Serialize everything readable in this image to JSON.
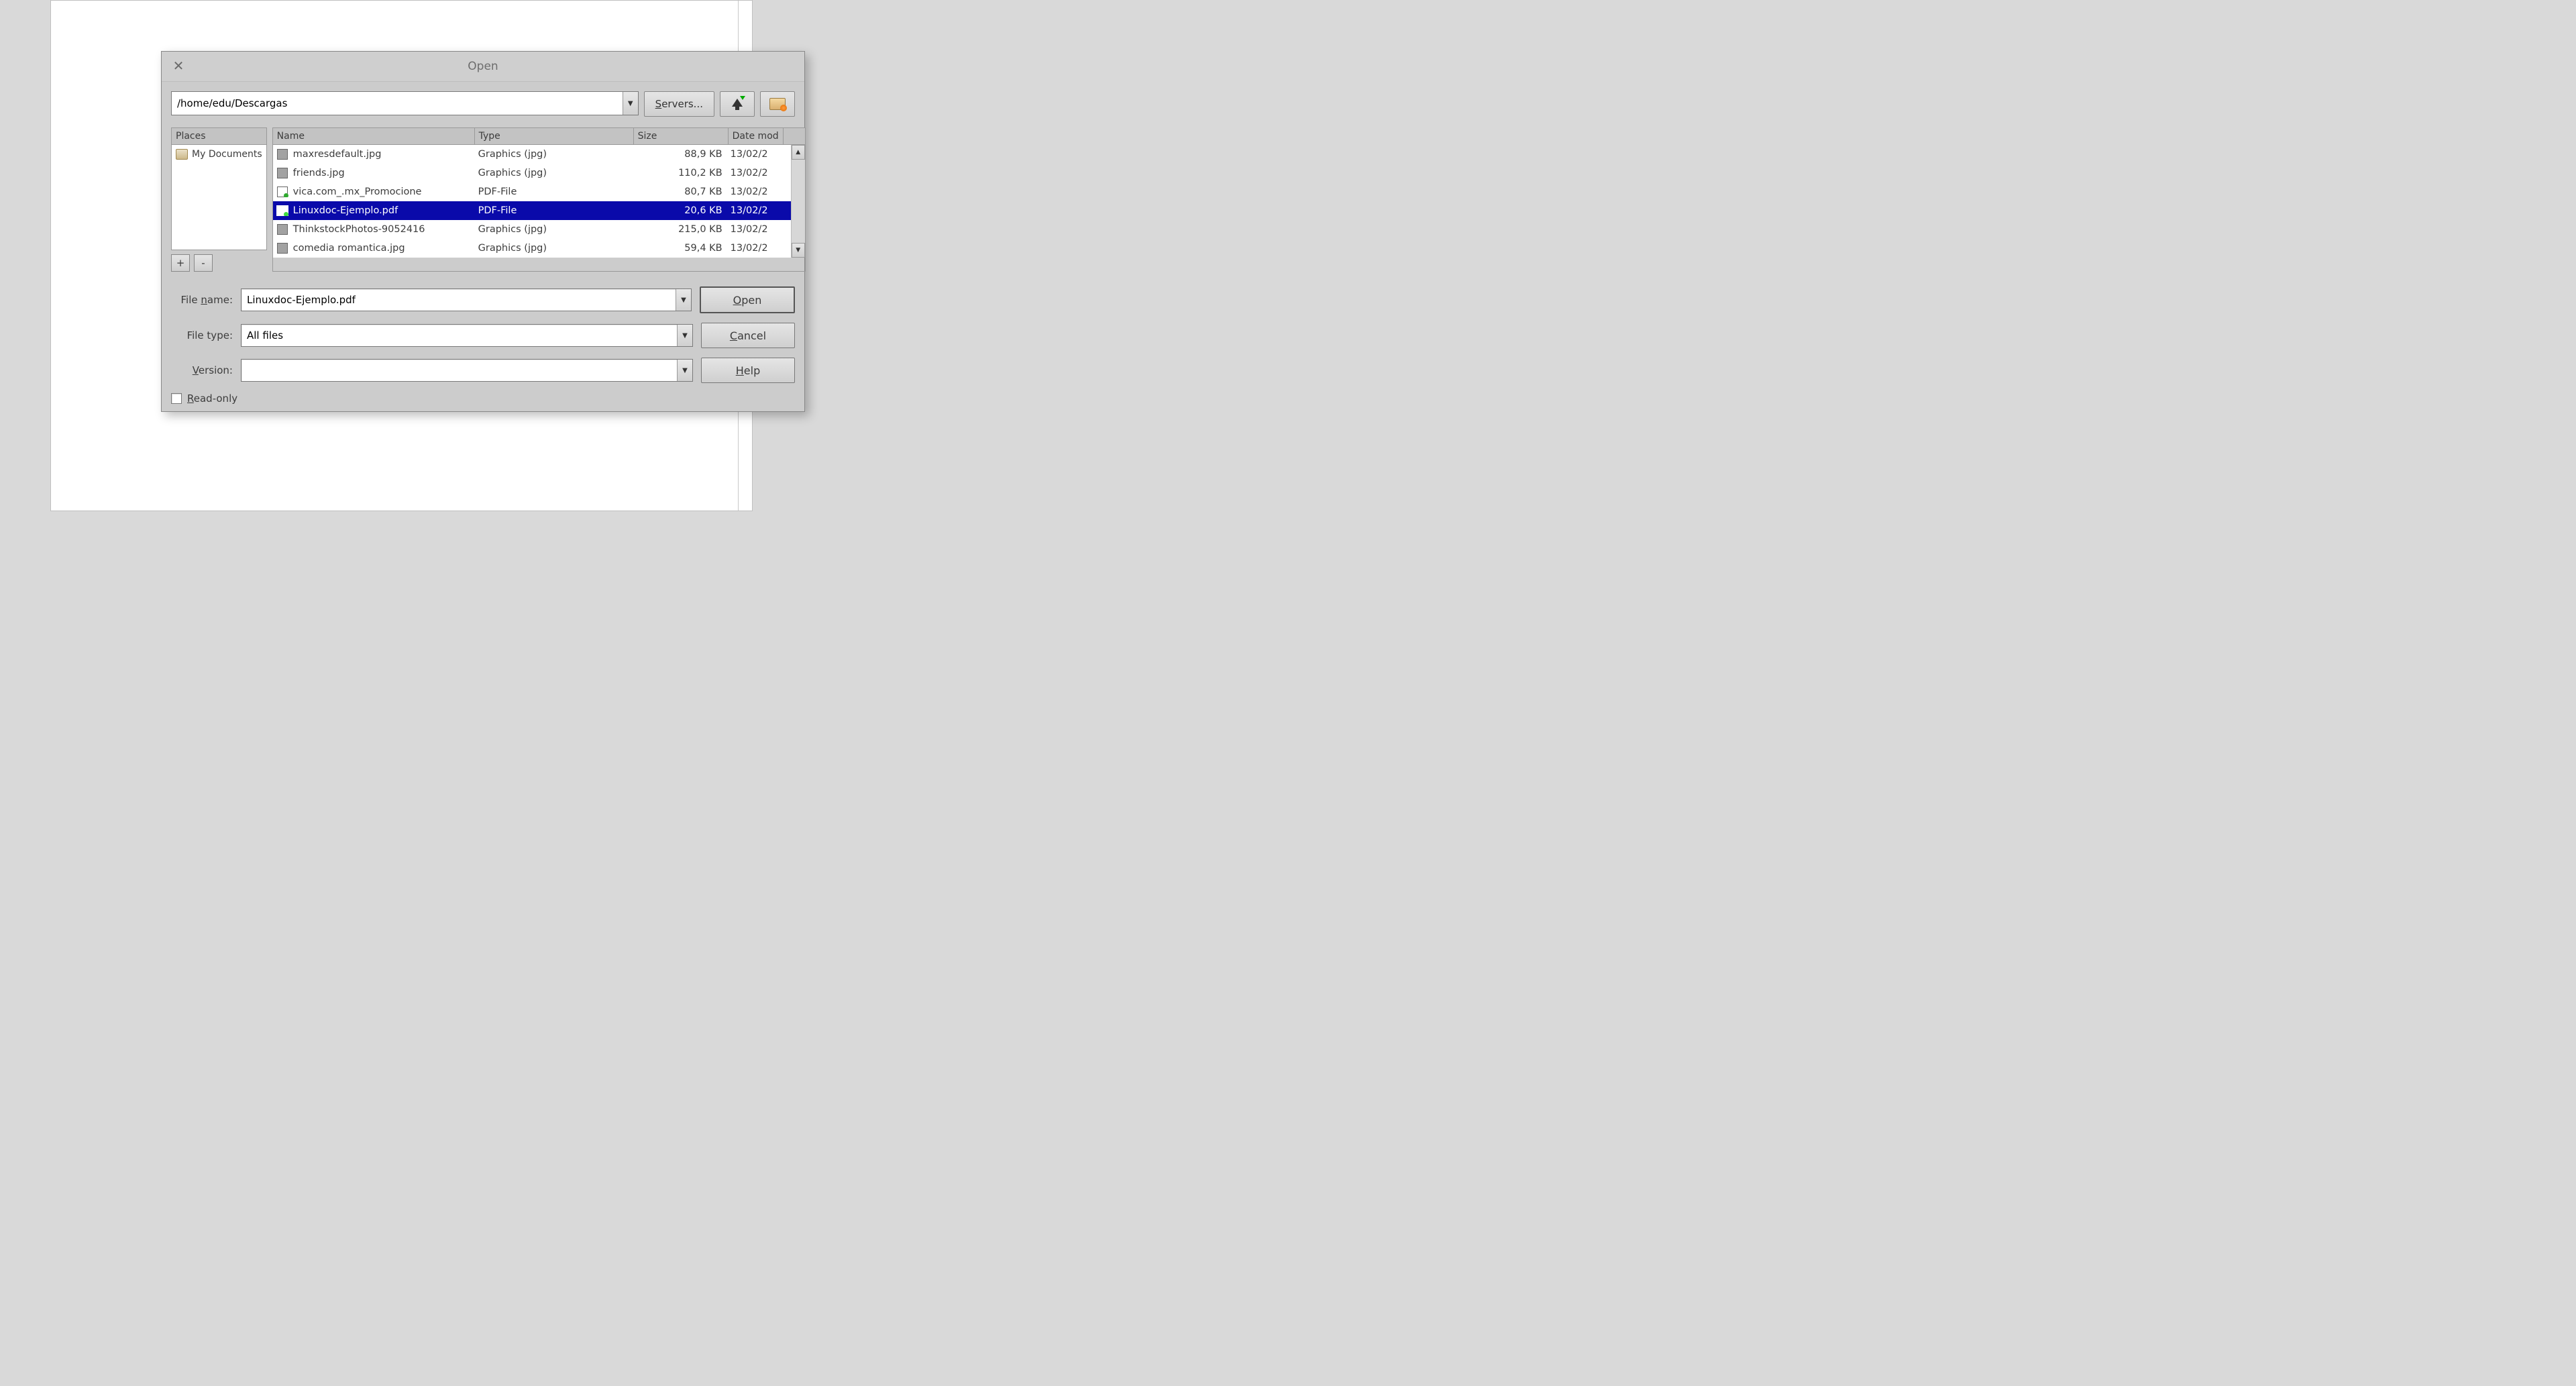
{
  "title": "Open",
  "path": "/home/edu/Descargas",
  "servers_label": "Servers...",
  "places": {
    "header": "Places",
    "items": [
      {
        "label": "My Documents"
      }
    ],
    "add_label": "+",
    "remove_label": "-"
  },
  "columns": {
    "name": "Name",
    "type": "Type",
    "size": "Size",
    "date": "Date mod"
  },
  "files": [
    {
      "name": "maxresdefault.jpg",
      "type": "Graphics (jpg)",
      "size": "88,9 KB",
      "date": "13/02/2",
      "kind": "img",
      "selected": false
    },
    {
      "name": "friends.jpg",
      "type": "Graphics (jpg)",
      "size": "110,2 KB",
      "date": "13/02/2",
      "kind": "img",
      "selected": false
    },
    {
      "name": "vica.com_.mx_Promocione",
      "type": "PDF-File",
      "size": "80,7 KB",
      "date": "13/02/2",
      "kind": "pdf",
      "selected": false
    },
    {
      "name": "Linuxdoc-Ejemplo.pdf",
      "type": "PDF-File",
      "size": "20,6 KB",
      "date": "13/02/2",
      "kind": "pdf",
      "selected": true
    },
    {
      "name": "ThinkstockPhotos-9052416",
      "type": "Graphics (jpg)",
      "size": "215,0 KB",
      "date": "13/02/2",
      "kind": "img",
      "selected": false
    },
    {
      "name": "comedia romantica.jpg",
      "type": "Graphics (jpg)",
      "size": "59,4 KB",
      "date": "13/02/2",
      "kind": "img",
      "selected": false
    }
  ],
  "form": {
    "filename_label_pre": "File ",
    "filename_label_u": "n",
    "filename_label_post": "ame:",
    "filename_value": "Linuxdoc-Ejemplo.pdf",
    "filetype_label": "File type:",
    "filetype_value": "All files",
    "version_label_u": "V",
    "version_label_post": "ersion:",
    "version_value": ""
  },
  "actions": {
    "open_u": "O",
    "open_post": "pen",
    "cancel_u": "C",
    "cancel_post": "ancel",
    "help_u": "H",
    "help_post": "elp"
  },
  "readonly": {
    "label_u": "R",
    "label_post": "ead-only"
  }
}
